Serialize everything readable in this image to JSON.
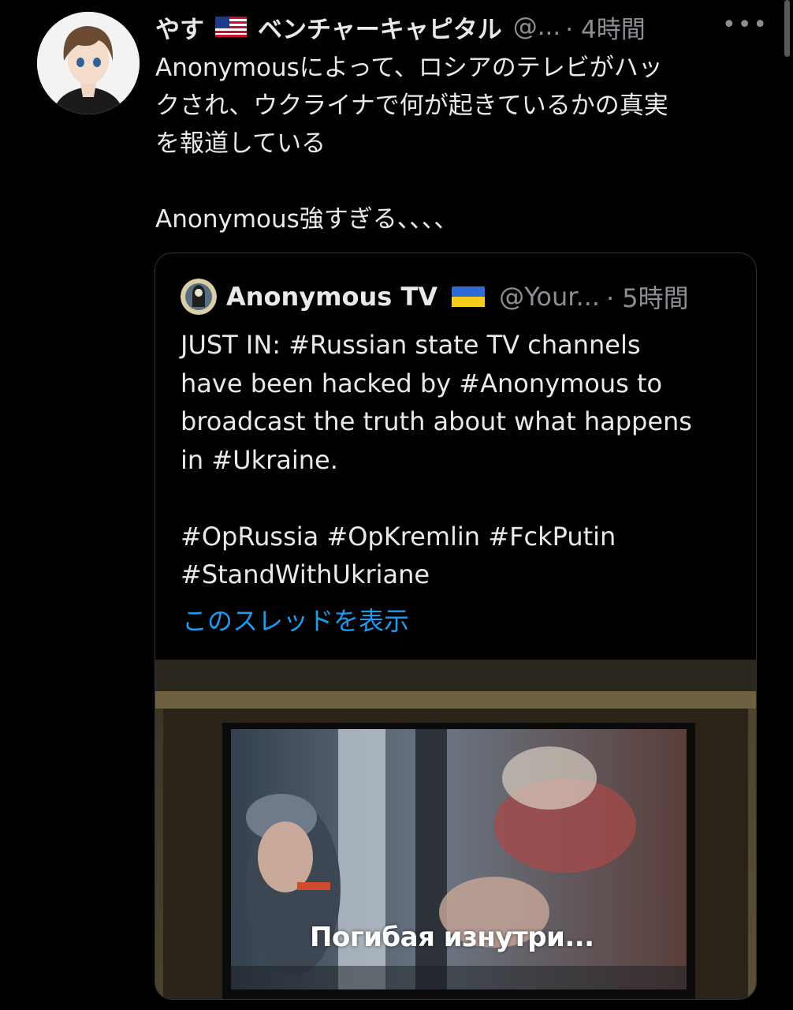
{
  "tweet": {
    "name": "やす",
    "name_suffix": "ベンチャーキャピタル",
    "handle": "@...",
    "time": "· 4時間",
    "more": "•••",
    "text": "Anonymousによって、ロシアのテレビがハッ\nクされ、ウクライナで何が起きているかの真実\nを報道している\n\nAnonymous強すぎる、、、、"
  },
  "quote": {
    "name": "Anonymous TV",
    "handle": "@Your...",
    "time": "· 5時間",
    "text": "JUST IN: #Russian state TV channels\nhave been hacked by #Anonymous to\nbroadcast the truth about what happens\nin #Ukraine.\n\n#OpRussia #OpKremlin #FckPutin\n#StandWithUkriane",
    "thread_link": "このスレッドを表示",
    "media_subtitle": "Погибая изнутри..."
  },
  "colors": {
    "background": "#000000",
    "text": "#e7e9ea",
    "secondary": "#8b8f94",
    "link": "#1d9bf0",
    "border": "#2f3336"
  },
  "icons": [
    "us-flag-icon",
    "ukraine-flag-icon",
    "more-icon",
    "avatar-icon"
  ]
}
